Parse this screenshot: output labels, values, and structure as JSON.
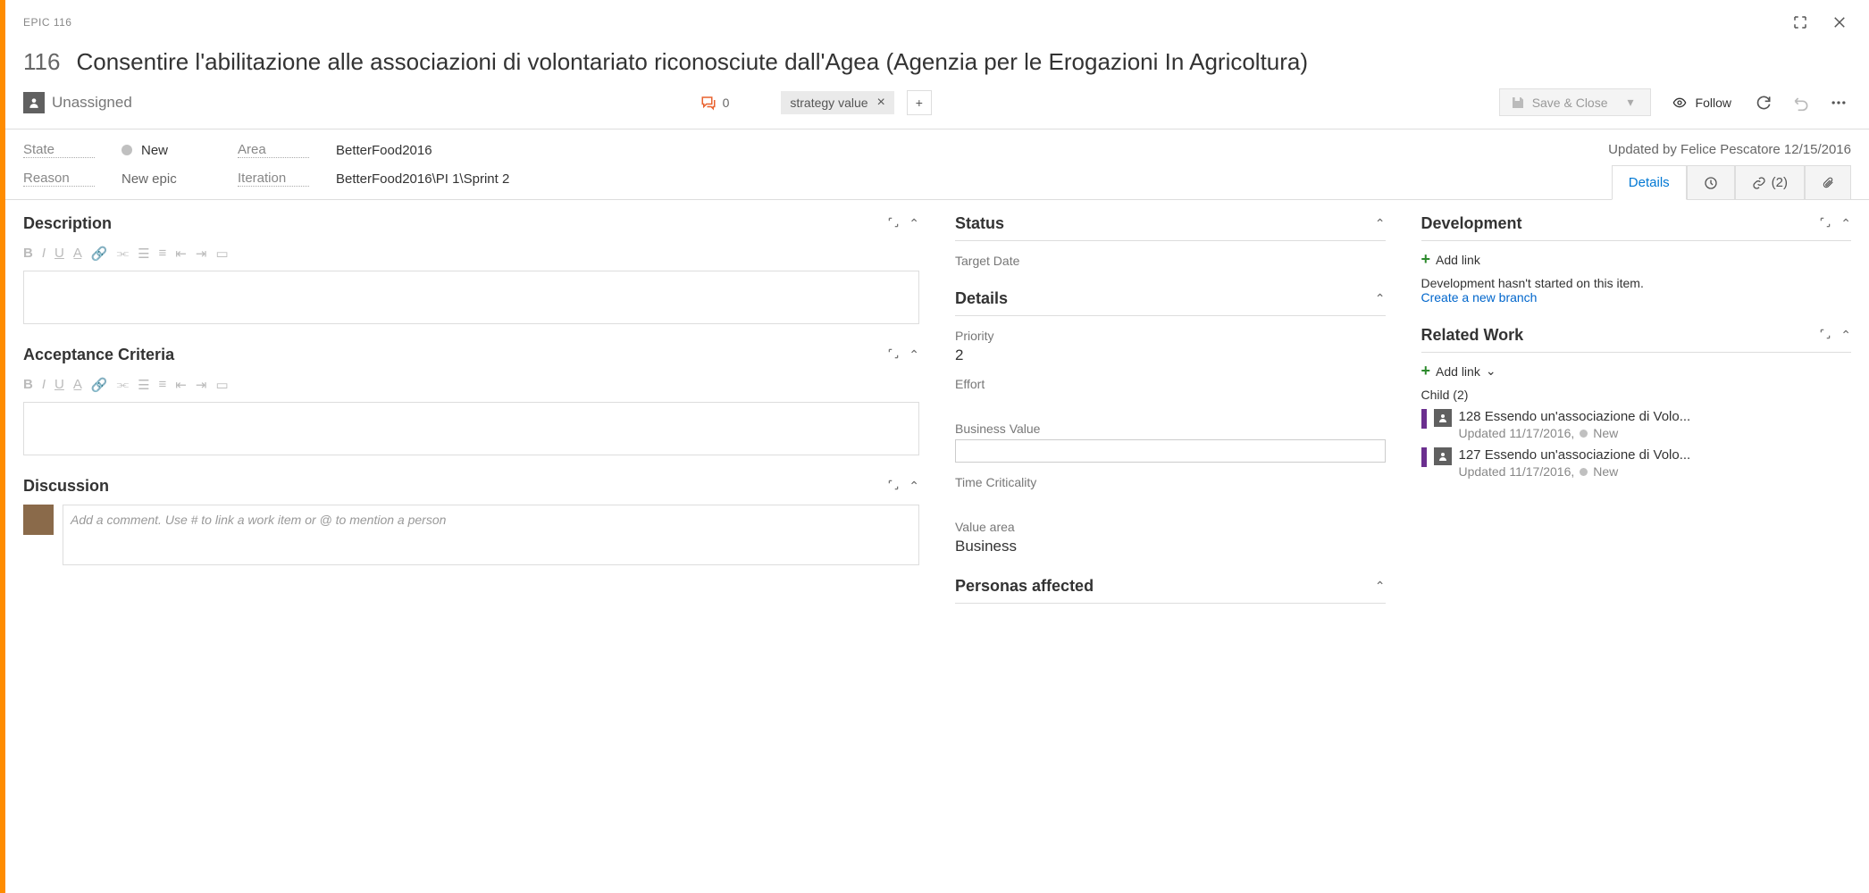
{
  "epic": {
    "type_label": "EPIC 116",
    "id": "116",
    "title": "Consentire l'abilitazione alle associazioni di volontariato riconosciute dall'Agea (Agenzia per le Erogazioni In Agricoltura)"
  },
  "toolbar": {
    "assignee": "Unassigned",
    "comment_count": "0",
    "tag": "strategy value",
    "save_close": "Save & Close",
    "follow": "Follow"
  },
  "meta": {
    "state_label": "State",
    "state_value": "New",
    "reason_label": "Reason",
    "reason_value": "New epic",
    "area_label": "Area",
    "area_value": "BetterFood2016",
    "iteration_label": "Iteration",
    "iteration_value": "BetterFood2016\\PI 1\\Sprint 2",
    "updated_by": "Updated by Felice Pescatore 12/15/2016"
  },
  "tabs": {
    "details": "Details",
    "links": "(2)"
  },
  "left": {
    "description": "Description",
    "acceptance": "Acceptance Criteria",
    "discussion": "Discussion",
    "comment_placeholder": "Add a comment. Use # to link a work item or @ to mention a person"
  },
  "mid": {
    "status": "Status",
    "target_date": "Target Date",
    "details": "Details",
    "priority_label": "Priority",
    "priority_value": "2",
    "effort": "Effort",
    "business_value": "Business Value",
    "time_criticality": "Time Criticality",
    "value_area_label": "Value area",
    "value_area_value": "Business",
    "personas": "Personas affected"
  },
  "right": {
    "development": "Development",
    "add_link": "Add link",
    "dev_empty": "Development hasn't started on this item.",
    "create_branch": "Create a new branch",
    "related_work": "Related Work",
    "child_header": "Child (2)",
    "children": [
      {
        "id": "128",
        "title": "Essendo un'associazione di Volo...",
        "meta": "Updated 11/17/2016,",
        "state": "New"
      },
      {
        "id": "127",
        "title": "Essendo un'associazione di Volo...",
        "meta": "Updated 11/17/2016,",
        "state": "New"
      }
    ]
  }
}
